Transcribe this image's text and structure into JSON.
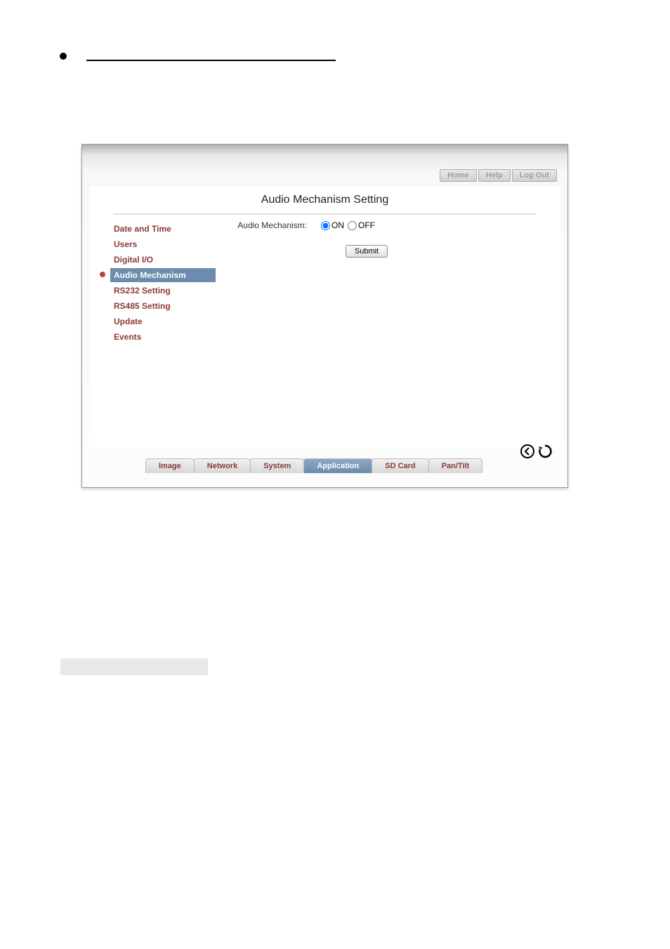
{
  "page_title": "Audio Mechanism Setting",
  "top_links": {
    "home": "Home",
    "help": "Help",
    "logout": "Log Out"
  },
  "sidebar": {
    "items": [
      {
        "label": "Date and Time",
        "active": false
      },
      {
        "label": "Users",
        "active": false
      },
      {
        "label": "Digital I/O",
        "active": false
      },
      {
        "label": "Audio Mechanism",
        "active": true
      },
      {
        "label": "RS232 Setting",
        "active": false
      },
      {
        "label": "RS485 Setting",
        "active": false
      },
      {
        "label": "Update",
        "active": false
      },
      {
        "label": "Events",
        "active": false
      }
    ]
  },
  "form": {
    "audio_mechanism_label": "Audio Mechanism:",
    "option_on": "ON",
    "option_off": "OFF",
    "selected": "ON",
    "submit_label": "Submit"
  },
  "tabs": {
    "items": [
      {
        "label": "Image",
        "active": false
      },
      {
        "label": "Network",
        "active": false
      },
      {
        "label": "System",
        "active": false
      },
      {
        "label": "Application",
        "active": true
      },
      {
        "label": "SD Card",
        "active": false
      },
      {
        "label": "Pan/Tilt",
        "active": false
      }
    ]
  }
}
